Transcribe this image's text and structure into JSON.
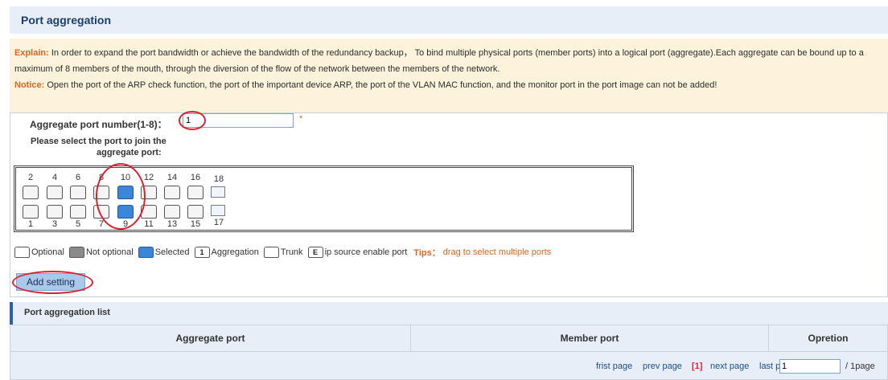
{
  "header": {
    "title": "Port aggregation"
  },
  "explain": {
    "explain_label": "Explain:",
    "explain_text": "In order to expand the port bandwidth or achieve the bandwidth of the redundancy backup， To bind multiple physical ports (member ports) into a logical port (aggregate).Each aggregate can be bound up to a maximum of 8 members of the mouth, through the diversion of the flow of the network between the members of the network.",
    "notice_label": "Notice:",
    "notice_text": "Open the port of the ARP check function, the port of the important device ARP, the port of the VLAN MAC function, and the monitor port in the port image can not be added!"
  },
  "form": {
    "agg_label": "Aggregate port number(1-8)：",
    "agg_value": "1",
    "required_mark": "*",
    "select_label_line1": "Please select the port to join the",
    "select_label_line2": "aggregate port:"
  },
  "ports": {
    "top_numbers": [
      "2",
      "4",
      "6",
      "8",
      "10",
      "12",
      "14",
      "16",
      "18"
    ],
    "bottom_numbers": [
      "1",
      "3",
      "5",
      "7",
      "9",
      "11",
      "13",
      "15",
      "17"
    ],
    "selected": [
      "9",
      "10"
    ],
    "fiber": [
      "17",
      "18"
    ]
  },
  "legend": {
    "optional": "Optional",
    "not_optional": "Not optional",
    "selected": "Selected",
    "aggregation_icon": "1",
    "aggregation": "Aggregation",
    "trunk": "Trunk",
    "ip_source_icon": "E",
    "ip_source": "ip source enable port",
    "tips_label": "Tips：",
    "tips_text": "drag to select multiple ports"
  },
  "buttons": {
    "add_setting": "Add setting"
  },
  "list": {
    "title": "Port aggregation list",
    "columns": [
      "Aggregate port",
      "Member port",
      "Opretion"
    ]
  },
  "pager": {
    "first": "frist page",
    "prev": "prev page",
    "current": "[1]",
    "next": "next page",
    "last": "last page",
    "page_input": "1",
    "total": "/ 1page"
  },
  "colors": {
    "accent": "#e0641c",
    "selected_port": "#3b86d6",
    "annotation_circle": "#d9222e",
    "header_bg": "#e7eef7"
  }
}
